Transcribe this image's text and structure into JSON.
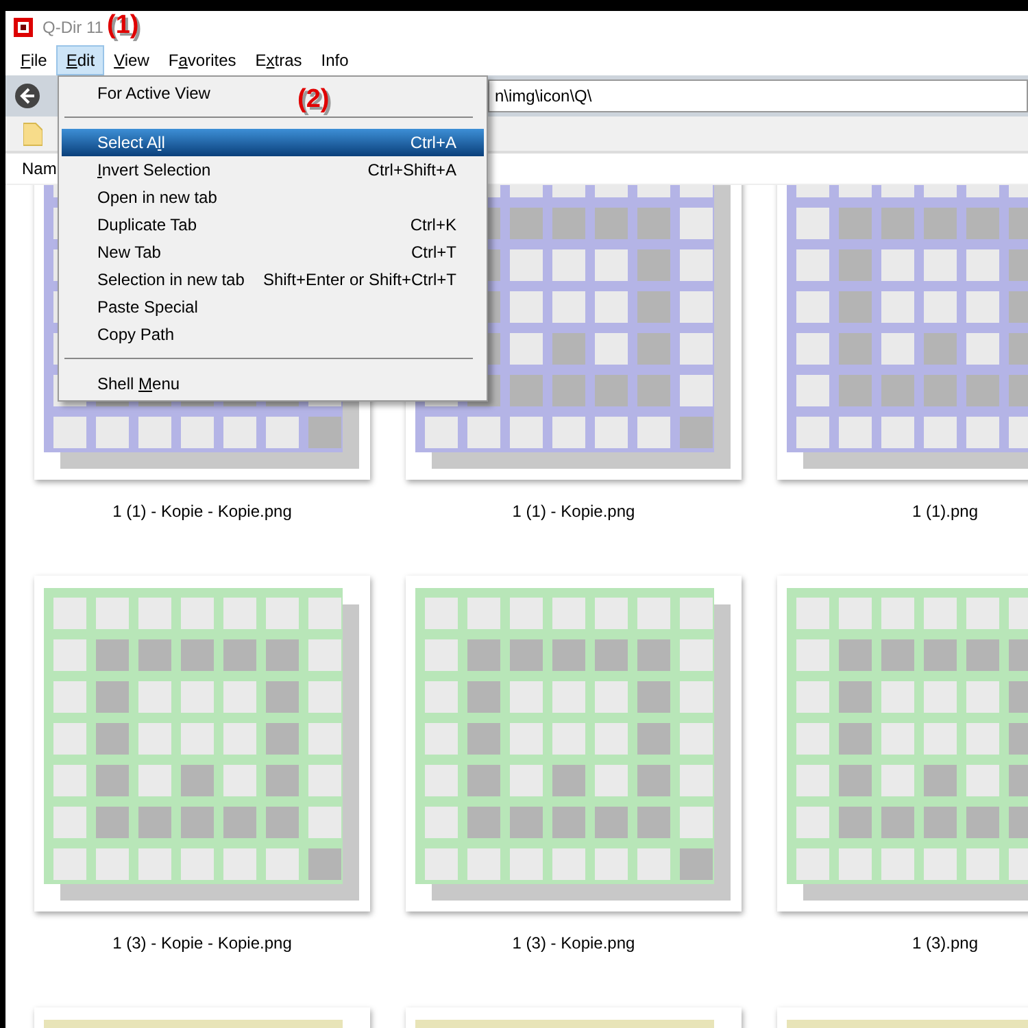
{
  "window": {
    "title": "Q-Dir 11"
  },
  "annotations": [
    "(1)",
    "(2)"
  ],
  "menubar": [
    {
      "key": "F",
      "after": "ile",
      "selected": false
    },
    {
      "key": "E",
      "after": "dit",
      "selected": true
    },
    {
      "key": "V",
      "after": "iew",
      "selected": false
    },
    {
      "before": "F",
      "key": "a",
      "after": "vorites",
      "selected": false
    },
    {
      "before": "E",
      "key": "x",
      "after": "tras",
      "selected": false
    },
    {
      "before": "Info",
      "selected": false
    }
  ],
  "address": {
    "value": "n\\img\\icon\\Q\\"
  },
  "column_header": "Nam",
  "edit_menu": [
    {
      "kind": "header",
      "before": "For Active View"
    },
    {
      "kind": "separator"
    },
    {
      "kind": "item",
      "before": "Select A",
      "key": "l",
      "after": "l",
      "shortcut": "Ctrl+A",
      "selected": true
    },
    {
      "kind": "item",
      "key": "I",
      "after": "nvert Selection",
      "shortcut": "Ctrl+Shift+A",
      "selected": false
    },
    {
      "kind": "item",
      "before": "Open in new tab",
      "selected": false
    },
    {
      "kind": "item",
      "before": "Duplicate Tab",
      "shortcut": "Ctrl+K",
      "selected": false
    },
    {
      "kind": "item",
      "before": "New Tab",
      "shortcut": "Ctrl+T",
      "selected": false
    },
    {
      "kind": "item",
      "before": "Selection in new tab",
      "shortcut": "Shift+Enter or Shift+Ctrl+T",
      "selected": false
    },
    {
      "kind": "item",
      "before": "Paste Special",
      "selected": false
    },
    {
      "kind": "item",
      "before": "Copy Path",
      "selected": false
    },
    {
      "kind": "separator"
    },
    {
      "kind": "item",
      "before": "Shell ",
      "key": "M",
      "after": "enu",
      "selected": false
    }
  ],
  "files": [
    {
      "name": "1 (1) - Kopie - Kopie.png",
      "color": "#b4b4e6"
    },
    {
      "name": "1 (1) - Kopie.png",
      "color": "#b4b4e6"
    },
    {
      "name": "1 (1).png",
      "color": "#b4b4e6"
    },
    {
      "name": "1 (3) - Kopie - Kopie.png",
      "color": "#b8e6b8"
    },
    {
      "name": "1 (3) - Kopie.png",
      "color": "#b8e6b8"
    },
    {
      "name": "1 (3).png",
      "color": "#b8e6b8"
    },
    {
      "color": "#e8e4b8"
    },
    {
      "color": "#e8e4b8"
    },
    {
      "color": "#e8e4b8"
    }
  ]
}
